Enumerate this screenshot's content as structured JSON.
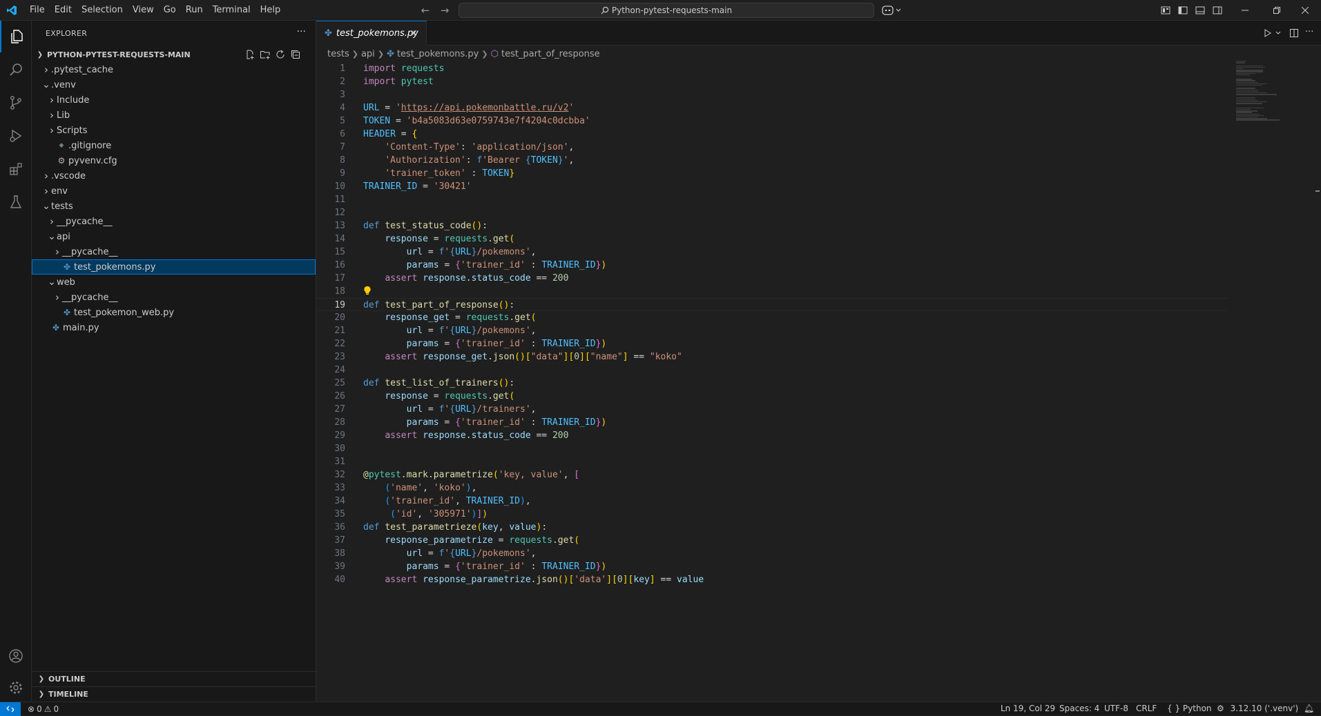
{
  "menu": [
    "File",
    "Edit",
    "Selection",
    "View",
    "Go",
    "Run",
    "Terminal",
    "Help"
  ],
  "command_center": "Python-pytest-requests-main",
  "explorer": {
    "title": "EXPLORER",
    "workspace": "PYTHON-PYTEST-REQUESTS-MAIN",
    "items": [
      {
        "label": ".pytest_cache",
        "twisty": ">",
        "icon": "",
        "depth": 1
      },
      {
        "label": ".venv",
        "twisty": "v",
        "icon": "",
        "depth": 1
      },
      {
        "label": "Include",
        "twisty": ">",
        "icon": "",
        "depth": 2
      },
      {
        "label": "Lib",
        "twisty": ">",
        "icon": "",
        "depth": 2
      },
      {
        "label": "Scripts",
        "twisty": ">",
        "icon": "",
        "depth": 2
      },
      {
        "label": ".gitignore",
        "twisty": "",
        "icon": "gitignore-icon",
        "depth": 2
      },
      {
        "label": "pyvenv.cfg",
        "twisty": "",
        "icon": "gear-file-icon",
        "depth": 2
      },
      {
        "label": ".vscode",
        "twisty": ">",
        "icon": "",
        "depth": 1
      },
      {
        "label": "env",
        "twisty": ">",
        "icon": "",
        "depth": 1
      },
      {
        "label": "tests",
        "twisty": "v",
        "icon": "",
        "depth": 1
      },
      {
        "label": "__pycache__",
        "twisty": ">",
        "icon": "",
        "depth": 2
      },
      {
        "label": "api",
        "twisty": "v",
        "icon": "",
        "depth": 2
      },
      {
        "label": "__pycache__",
        "twisty": ">",
        "icon": "",
        "depth": 3
      },
      {
        "label": "test_pokemons.py",
        "twisty": "",
        "icon": "python-icon",
        "depth": 3,
        "selected": true
      },
      {
        "label": "web",
        "twisty": "v",
        "icon": "",
        "depth": 2
      },
      {
        "label": "__pycache__",
        "twisty": ">",
        "icon": "",
        "depth": 3
      },
      {
        "label": "test_pokemon_web.py",
        "twisty": "",
        "icon": "python-icon",
        "depth": 3
      },
      {
        "label": "main.py",
        "twisty": "",
        "icon": "python-icon",
        "depth": 1
      }
    ],
    "outline": "OUTLINE",
    "timeline": "TIMELINE"
  },
  "tab": {
    "label": "test_pokemons.py"
  },
  "breadcrumb": [
    "tests",
    "api",
    "test_pokemons.py",
    "test_part_of_response"
  ],
  "editor": {
    "current_line": 19,
    "lines": [
      [
        [
          "kw",
          "import"
        ],
        [
          "",
          " "
        ],
        [
          "mod",
          "requests"
        ]
      ],
      [
        [
          "kw",
          "import"
        ],
        [
          "",
          " "
        ],
        [
          "mod",
          "pytest"
        ]
      ],
      [],
      [
        [
          "const",
          "URL"
        ],
        [
          "op",
          " = "
        ],
        [
          "str",
          "'"
        ],
        [
          "url",
          "https://api.pokemonbattle.ru/v2"
        ],
        [
          "str",
          "'"
        ]
      ],
      [
        [
          "const",
          "TOKEN"
        ],
        [
          "op",
          " = "
        ],
        [
          "str",
          "'b4a5083d63e0759743e7f4204c0dcbba'"
        ]
      ],
      [
        [
          "const",
          "HEADER"
        ],
        [
          "op",
          " = "
        ],
        [
          "br1",
          "{"
        ]
      ],
      [
        [
          "",
          "    "
        ],
        [
          "str",
          "'Content-Type'"
        ],
        [
          "op",
          ": "
        ],
        [
          "str",
          "'application/json'"
        ],
        [
          "op",
          ","
        ]
      ],
      [
        [
          "",
          "    "
        ],
        [
          "str",
          "'Authorization'"
        ],
        [
          "op",
          ": "
        ],
        [
          "def",
          "f"
        ],
        [
          "str",
          "'Bearer "
        ],
        [
          "def",
          "{"
        ],
        [
          "const",
          "TOKEN"
        ],
        [
          "def",
          "}"
        ],
        [
          "str",
          "'"
        ],
        [
          "op",
          ","
        ]
      ],
      [
        [
          "",
          "    "
        ],
        [
          "str",
          "'trainer_token'"
        ],
        [
          "op",
          " : "
        ],
        [
          "const",
          "TOKEN"
        ],
        [
          "br1",
          "}"
        ]
      ],
      [
        [
          "const",
          "TRAINER_ID"
        ],
        [
          "op",
          " = "
        ],
        [
          "str",
          "'30421'"
        ]
      ],
      [],
      [],
      [
        [
          "def",
          "def"
        ],
        [
          "op",
          " "
        ],
        [
          "fn",
          "test_status_code"
        ],
        [
          "br1",
          "()"
        ],
        [
          "op",
          ":"
        ]
      ],
      [
        [
          "",
          "    "
        ],
        [
          "var",
          "response"
        ],
        [
          "op",
          " = "
        ],
        [
          "mod",
          "requests"
        ],
        [
          "op",
          "."
        ],
        [
          "fn",
          "get"
        ],
        [
          "br1",
          "("
        ]
      ],
      [
        [
          "",
          "        "
        ],
        [
          "var",
          "url"
        ],
        [
          "op",
          " = "
        ],
        [
          "def",
          "f"
        ],
        [
          "str",
          "'"
        ],
        [
          "def",
          "{"
        ],
        [
          "const",
          "URL"
        ],
        [
          "def",
          "}"
        ],
        [
          "str",
          "/pokemons'"
        ],
        [
          "op",
          ","
        ]
      ],
      [
        [
          "",
          "        "
        ],
        [
          "var",
          "params"
        ],
        [
          "op",
          " = "
        ],
        [
          "br2",
          "{"
        ],
        [
          "str",
          "'trainer_id'"
        ],
        [
          "op",
          " : "
        ],
        [
          "const",
          "TRAINER_ID"
        ],
        [
          "br2",
          "}"
        ],
        [
          "br1",
          ")"
        ]
      ],
      [
        [
          "",
          "    "
        ],
        [
          "kw",
          "assert"
        ],
        [
          "op",
          " "
        ],
        [
          "var",
          "response"
        ],
        [
          "op",
          "."
        ],
        [
          "var",
          "status_code"
        ],
        [
          "op",
          " == "
        ],
        [
          "num",
          "200"
        ]
      ],
      [],
      [
        [
          "def",
          "def"
        ],
        [
          "op",
          " "
        ],
        [
          "fn",
          "test_part_of_response"
        ],
        [
          "br1",
          "()"
        ],
        [
          "op",
          ":"
        ]
      ],
      [
        [
          "",
          "    "
        ],
        [
          "var",
          "response_get"
        ],
        [
          "op",
          " = "
        ],
        [
          "mod",
          "requests"
        ],
        [
          "op",
          "."
        ],
        [
          "fn",
          "get"
        ],
        [
          "br1",
          "("
        ]
      ],
      [
        [
          "",
          "        "
        ],
        [
          "var",
          "url"
        ],
        [
          "op",
          " = "
        ],
        [
          "def",
          "f"
        ],
        [
          "str",
          "'"
        ],
        [
          "def",
          "{"
        ],
        [
          "const",
          "URL"
        ],
        [
          "def",
          "}"
        ],
        [
          "str",
          "/pokemons'"
        ],
        [
          "op",
          ","
        ]
      ],
      [
        [
          "",
          "        "
        ],
        [
          "var",
          "params"
        ],
        [
          "op",
          " = "
        ],
        [
          "br2",
          "{"
        ],
        [
          "str",
          "'trainer_id'"
        ],
        [
          "op",
          " : "
        ],
        [
          "const",
          "TRAINER_ID"
        ],
        [
          "br2",
          "}"
        ],
        [
          "br1",
          ")"
        ]
      ],
      [
        [
          "",
          "    "
        ],
        [
          "kw",
          "assert"
        ],
        [
          "op",
          " "
        ],
        [
          "var",
          "response_get"
        ],
        [
          "op",
          "."
        ],
        [
          "fn",
          "json"
        ],
        [
          "br1",
          "()"
        ],
        [
          "br1",
          "["
        ],
        [
          "str",
          "\"data\""
        ],
        [
          "br1",
          "]"
        ],
        [
          "br1",
          "["
        ],
        [
          "num",
          "0"
        ],
        [
          "br1",
          "]"
        ],
        [
          "br1",
          "["
        ],
        [
          "str",
          "\"name\""
        ],
        [
          "br1",
          "]"
        ],
        [
          "op",
          " == "
        ],
        [
          "str",
          "\"koko\""
        ]
      ],
      [],
      [
        [
          "def",
          "def"
        ],
        [
          "op",
          " "
        ],
        [
          "fn",
          "test_list_of_trainers"
        ],
        [
          "br1",
          "()"
        ],
        [
          "op",
          ":"
        ]
      ],
      [
        [
          "",
          "    "
        ],
        [
          "var",
          "response"
        ],
        [
          "op",
          " = "
        ],
        [
          "mod",
          "requests"
        ],
        [
          "op",
          "."
        ],
        [
          "fn",
          "get"
        ],
        [
          "br1",
          "("
        ]
      ],
      [
        [
          "",
          "        "
        ],
        [
          "var",
          "url"
        ],
        [
          "op",
          " = "
        ],
        [
          "def",
          "f"
        ],
        [
          "str",
          "'"
        ],
        [
          "def",
          "{"
        ],
        [
          "const",
          "URL"
        ],
        [
          "def",
          "}"
        ],
        [
          "str",
          "/trainers'"
        ],
        [
          "op",
          ","
        ]
      ],
      [
        [
          "",
          "        "
        ],
        [
          "var",
          "params"
        ],
        [
          "op",
          " = "
        ],
        [
          "br2",
          "{"
        ],
        [
          "str",
          "'trainer_id'"
        ],
        [
          "op",
          " : "
        ],
        [
          "const",
          "TRAINER_ID"
        ],
        [
          "br2",
          "}"
        ],
        [
          "br1",
          ")"
        ]
      ],
      [
        [
          "",
          "    "
        ],
        [
          "kw",
          "assert"
        ],
        [
          "op",
          " "
        ],
        [
          "var",
          "response"
        ],
        [
          "op",
          "."
        ],
        [
          "var",
          "status_code"
        ],
        [
          "op",
          " == "
        ],
        [
          "num",
          "200"
        ]
      ],
      [],
      [],
      [
        [
          "fn",
          "@"
        ],
        [
          "mod",
          "pytest"
        ],
        [
          "op",
          "."
        ],
        [
          "fn",
          "mark"
        ],
        [
          "op",
          "."
        ],
        [
          "fn",
          "parametrize"
        ],
        [
          "br1",
          "("
        ],
        [
          "str",
          "'key, value'"
        ],
        [
          "op",
          ", "
        ],
        [
          "br2",
          "["
        ]
      ],
      [
        [
          "",
          "    "
        ],
        [
          "br3",
          "("
        ],
        [
          "str",
          "'name'"
        ],
        [
          "op",
          ", "
        ],
        [
          "str",
          "'koko'"
        ],
        [
          "br3",
          ")"
        ],
        [
          "op",
          ","
        ]
      ],
      [
        [
          "",
          "    "
        ],
        [
          "br3",
          "("
        ],
        [
          "str",
          "'trainer_id'"
        ],
        [
          "op",
          ", "
        ],
        [
          "const",
          "TRAINER_ID"
        ],
        [
          "br3",
          ")"
        ],
        [
          "op",
          ","
        ]
      ],
      [
        [
          "",
          "     "
        ],
        [
          "br3",
          "("
        ],
        [
          "str",
          "'id'"
        ],
        [
          "op",
          ", "
        ],
        [
          "str",
          "'305971'"
        ],
        [
          "br3",
          ")"
        ],
        [
          "br2",
          "]"
        ],
        [
          "br1",
          ")"
        ]
      ],
      [
        [
          "def",
          "def"
        ],
        [
          "op",
          " "
        ],
        [
          "fn",
          "test_parametrieze"
        ],
        [
          "br1",
          "("
        ],
        [
          "var",
          "key"
        ],
        [
          "op",
          ", "
        ],
        [
          "var",
          "value"
        ],
        [
          "br1",
          ")"
        ],
        [
          "op",
          ":"
        ]
      ],
      [
        [
          "",
          "    "
        ],
        [
          "var",
          "response_parametrize"
        ],
        [
          "op",
          " = "
        ],
        [
          "mod",
          "requests"
        ],
        [
          "op",
          "."
        ],
        [
          "fn",
          "get"
        ],
        [
          "br1",
          "("
        ]
      ],
      [
        [
          "",
          "        "
        ],
        [
          "var",
          "url"
        ],
        [
          "op",
          " = "
        ],
        [
          "def",
          "f"
        ],
        [
          "str",
          "'"
        ],
        [
          "def",
          "{"
        ],
        [
          "const",
          "URL"
        ],
        [
          "def",
          "}"
        ],
        [
          "str",
          "/pokemons'"
        ],
        [
          "op",
          ","
        ]
      ],
      [
        [
          "",
          "        "
        ],
        [
          "var",
          "params"
        ],
        [
          "op",
          " = "
        ],
        [
          "br2",
          "{"
        ],
        [
          "str",
          "'trainer_id'"
        ],
        [
          "op",
          " : "
        ],
        [
          "const",
          "TRAINER_ID"
        ],
        [
          "br2",
          "}"
        ],
        [
          "br1",
          ")"
        ]
      ],
      [
        [
          "",
          "    "
        ],
        [
          "kw",
          "assert"
        ],
        [
          "op",
          " "
        ],
        [
          "var",
          "response_parametrize"
        ],
        [
          "op",
          "."
        ],
        [
          "fn",
          "json"
        ],
        [
          "br1",
          "()"
        ],
        [
          "br1",
          "["
        ],
        [
          "str",
          "'data'"
        ],
        [
          "br1",
          "]"
        ],
        [
          "br1",
          "["
        ],
        [
          "num",
          "0"
        ],
        [
          "br1",
          "]"
        ],
        [
          "br1",
          "["
        ],
        [
          "var",
          "key"
        ],
        [
          "br1",
          "]"
        ],
        [
          "op",
          " == "
        ],
        [
          "var",
          "value"
        ]
      ]
    ]
  },
  "status": {
    "errors": "0",
    "warnings": "0",
    "position": "Ln 19, Col 29",
    "spaces": "Spaces: 4",
    "encoding": "UTF-8",
    "eol": "CRLF",
    "language_prefix": "{ }",
    "language": "Python",
    "interpreter": "3.12.10 ('.venv')"
  },
  "colors": {
    "accent": "#0078d4",
    "background": "#1f1f1f",
    "sidebar": "#181818"
  }
}
